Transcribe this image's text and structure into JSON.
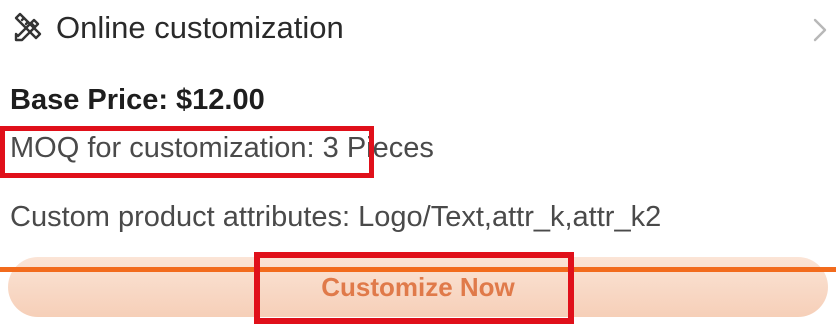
{
  "header": {
    "title": "Online customization",
    "icon": "tools-icon",
    "chevron_icon": "chevron-right-icon"
  },
  "pricing": {
    "base_price": "Base Price: $12.00",
    "moq_label": "MOQ for customization:",
    "moq_value": " 3 Pieces",
    "attributes": "Custom product attributes: Logo/Text,attr_k,attr_k2"
  },
  "actions": {
    "customize_label": "Customize Now"
  },
  "colors": {
    "highlight_box": "#e0101a",
    "divider_line": "#f26b1d",
    "button_text": "#e07a4a",
    "button_bg": "#f6cfb8"
  }
}
